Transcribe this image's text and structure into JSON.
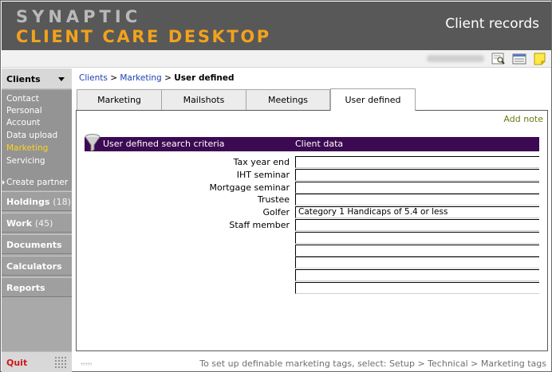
{
  "header": {
    "brand_line1": "SYNAPTIC",
    "brand_line2": "CLIENT CARE DESKTOP",
    "title": "Client records"
  },
  "toolbar": {
    "icons": [
      "search-document-icon",
      "list-view-icon",
      "sticky-note-icon"
    ]
  },
  "sidebar": {
    "section_title": "Clients",
    "menu_items": [
      {
        "label": "Contact",
        "active": false
      },
      {
        "label": "Personal",
        "active": false
      },
      {
        "label": "Account",
        "active": false
      },
      {
        "label": "Data upload",
        "active": false
      },
      {
        "label": "Marketing",
        "active": true
      },
      {
        "label": "Servicing",
        "active": false
      }
    ],
    "create_partner": "Create partner",
    "buttons": [
      {
        "label": "Holdings",
        "count": "(18)"
      },
      {
        "label": "Work",
        "count": "(45)"
      },
      {
        "label": "Documents",
        "count": ""
      },
      {
        "label": "Calculators",
        "count": ""
      },
      {
        "label": "Reports",
        "count": ""
      }
    ],
    "quit": "Quit"
  },
  "breadcrumb": {
    "items": [
      "Clients",
      "Marketing"
    ],
    "separator": ">",
    "current": "User defined"
  },
  "tabs": [
    {
      "label": "Marketing",
      "active": false
    },
    {
      "label": "Mailshots",
      "active": false
    },
    {
      "label": "Meetings",
      "active": false
    },
    {
      "label": "User defined",
      "active": true
    }
  ],
  "panel": {
    "add_note": "Add note",
    "header_criteria": "User defined search criteria",
    "header_data": "Client data",
    "rows": [
      {
        "label": "Tax year end",
        "value": ""
      },
      {
        "label": "IHT seminar",
        "value": ""
      },
      {
        "label": "Mortgage seminar",
        "value": ""
      },
      {
        "label": "Trustee",
        "value": ""
      },
      {
        "label": "Golfer",
        "value": "Category 1 Handicaps of 5.4 or less"
      },
      {
        "label": "Staff member",
        "value": ""
      },
      {
        "label": "",
        "value": ""
      },
      {
        "label": "",
        "value": ""
      },
      {
        "label": "",
        "value": ""
      },
      {
        "label": "",
        "value": ""
      },
      {
        "label": "",
        "value": ""
      }
    ]
  },
  "status": {
    "text": "To set up definable marketing tags, select: Setup > Technical > Marketing tags"
  },
  "colors": {
    "header_bg": "#585858",
    "brand_orange": "#f2a21c",
    "criteria_bar": "#3b0a52",
    "active_menu": "#ffd11a",
    "quit_red": "#cc1a1a",
    "link_blue": "#1a3fb3",
    "add_note_olive": "#6b7a10"
  }
}
